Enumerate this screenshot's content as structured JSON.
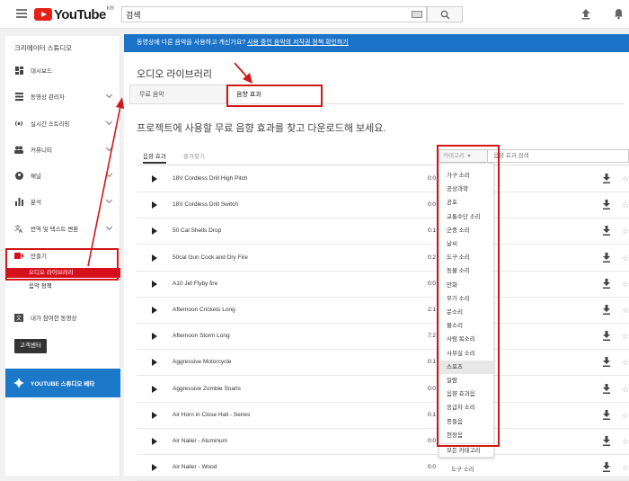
{
  "header": {
    "logo_text": "YouTube",
    "logo_region": "KR",
    "search_value": "검색"
  },
  "sidebar": {
    "title": "크리에이터 스튜디오",
    "items": [
      {
        "label": "대시보드",
        "icon": "dashboard-icon",
        "chevron": false
      },
      {
        "label": "동영상 관리자",
        "icon": "video-manager-icon",
        "chevron": true
      },
      {
        "label": "실시간 스트리밍",
        "icon": "live-icon",
        "chevron": true
      },
      {
        "label": "커뮤니티",
        "icon": "community-icon",
        "chevron": true
      },
      {
        "label": "채널",
        "icon": "channel-icon",
        "chevron": true
      },
      {
        "label": "분석",
        "icon": "analytics-icon",
        "chevron": true
      },
      {
        "label": "번역 및 텍스트 변환",
        "icon": "translate-icon",
        "chevron": true
      },
      {
        "label": "만들기",
        "icon": "create-icon",
        "chevron": false
      }
    ],
    "sub_items": [
      "오디오 라이브러리",
      "음악 정책"
    ],
    "contributed_videos": "내가 참여한 동영상",
    "help_center": "고객센터",
    "studio_beta": "YOUTUBE 스튜디오 베타"
  },
  "banner": {
    "text": "동영상에 다른 음악을 사용하고 계신가요?",
    "link": "사용 중인 음악의 저작권 정책 확인하기"
  },
  "main": {
    "title": "오디오 라이브러리",
    "tabs": [
      "무료 음악",
      "음향 효과"
    ],
    "description": "프로젝트에 사용할 무료 음향 효과를 찾고 다운로드해 보세요.",
    "subtabs": [
      "음향 효과",
      "즐겨찾기"
    ],
    "category_button": "카테고리",
    "search_placeholder": "음향 효과 검색"
  },
  "tracks": [
    {
      "name": "18V Cordless Drill High Pitch",
      "duration": "0:0"
    },
    {
      "name": "18V Cordless Drill Switch",
      "duration": "0:0"
    },
    {
      "name": "50 Cal Shells Drop",
      "duration": "0:1"
    },
    {
      "name": "50cal Gun Cock and Dry Fire",
      "duration": "0:2"
    },
    {
      "name": "A10 Jet Flyby fire",
      "duration": "0:0"
    },
    {
      "name": "Afternoon Crickets Long",
      "duration": "2:1"
    },
    {
      "name": "Afternoon Storm Long",
      "duration": "7:2"
    },
    {
      "name": "Aggressive Motorcycle",
      "duration": "0:1"
    },
    {
      "name": "Aggressive Zombie Snarls",
      "duration": "0:0"
    },
    {
      "name": "Air Horn in Close Hall - Series",
      "duration": "0:1"
    },
    {
      "name": "Air Nailer - Aluminum",
      "duration": "0:0"
    },
    {
      "name": "Air Nailer - Wood",
      "duration": "0:0"
    }
  ],
  "category_dropdown": {
    "items": [
      "가구 소리",
      "공상과학",
      "공포",
      "교통수단 소리",
      "군중 소리",
      "날씨",
      "도구 소리",
      "동물 소리",
      "만화",
      "무기 소리",
      "문소리",
      "물소리",
      "사람 목소리",
      "사무실 소리",
      "스포츠",
      "알람",
      "음향 효과음",
      "응급차 소리",
      "종들음",
      "현장음"
    ],
    "highlighted": "스포츠",
    "all_categories": "모든 카테고리",
    "partial_text": "도구 소리"
  }
}
